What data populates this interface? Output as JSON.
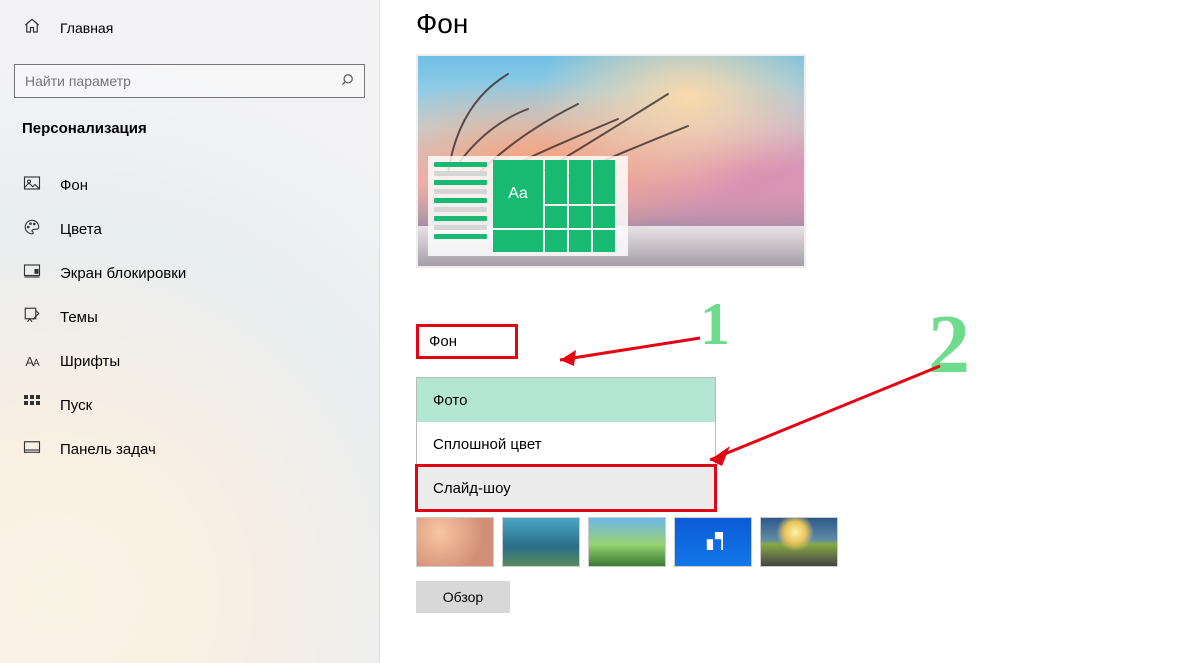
{
  "sidebar": {
    "home_label": "Главная",
    "search_placeholder": "Найти параметр",
    "section_title": "Персонализация",
    "items": [
      {
        "icon": "picture-icon",
        "label": "Фон"
      },
      {
        "icon": "palette-icon",
        "label": "Цвета"
      },
      {
        "icon": "lockscreen-icon",
        "label": "Экран блокировки"
      },
      {
        "icon": "themes-icon",
        "label": "Темы"
      },
      {
        "icon": "fonts-icon",
        "label": "Шрифты"
      },
      {
        "icon": "start-icon",
        "label": "Пуск"
      },
      {
        "icon": "taskbar-icon",
        "label": "Панель задач"
      }
    ]
  },
  "main": {
    "title": "Фон",
    "preview_tile_text": "Aa",
    "bg_section_label": "Фон",
    "dropdown_options": [
      "Фото",
      "Сплошной цвет",
      "Слайд-шоу"
    ],
    "dropdown_selected_index": 0,
    "browse_label": "Обзор"
  },
  "annotations": {
    "num1": "1",
    "num2": "2",
    "highlight_color": "#e30514",
    "marker_color": "#6fdc8d"
  }
}
